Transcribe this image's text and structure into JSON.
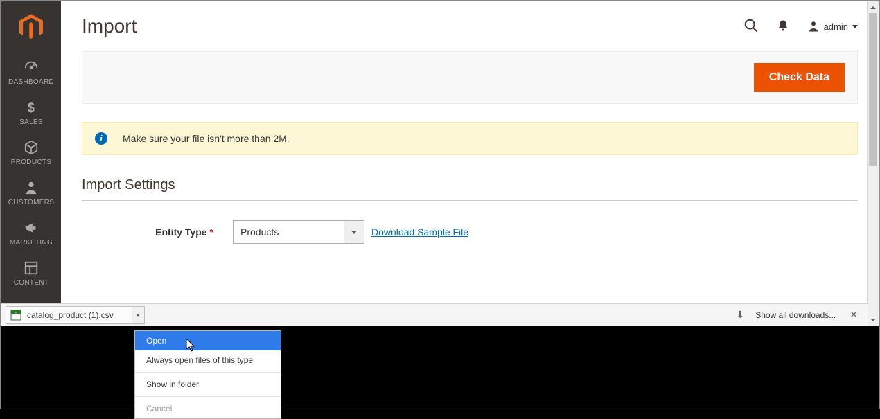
{
  "header": {
    "title": "Import",
    "user": "admin"
  },
  "actions": {
    "check_data": "Check Data"
  },
  "alert": {
    "message": "Make sure your file isn't more than 2M."
  },
  "section": {
    "title": "Import Settings"
  },
  "form": {
    "entity_type_label": "Entity Type",
    "entity_type_value": "Products",
    "download_sample": "Download Sample File"
  },
  "sidebar": {
    "items": [
      {
        "label": "DASHBOARD"
      },
      {
        "label": "SALES"
      },
      {
        "label": "PRODUCTS"
      },
      {
        "label": "CUSTOMERS"
      },
      {
        "label": "MARKETING"
      },
      {
        "label": "CONTENT"
      }
    ]
  },
  "downloads": {
    "file": "catalog_product (1).csv",
    "show_all": "Show all downloads..."
  },
  "context_menu": {
    "open": "Open",
    "always": "Always open files of this type",
    "show": "Show in folder",
    "cancel": "Cancel"
  }
}
